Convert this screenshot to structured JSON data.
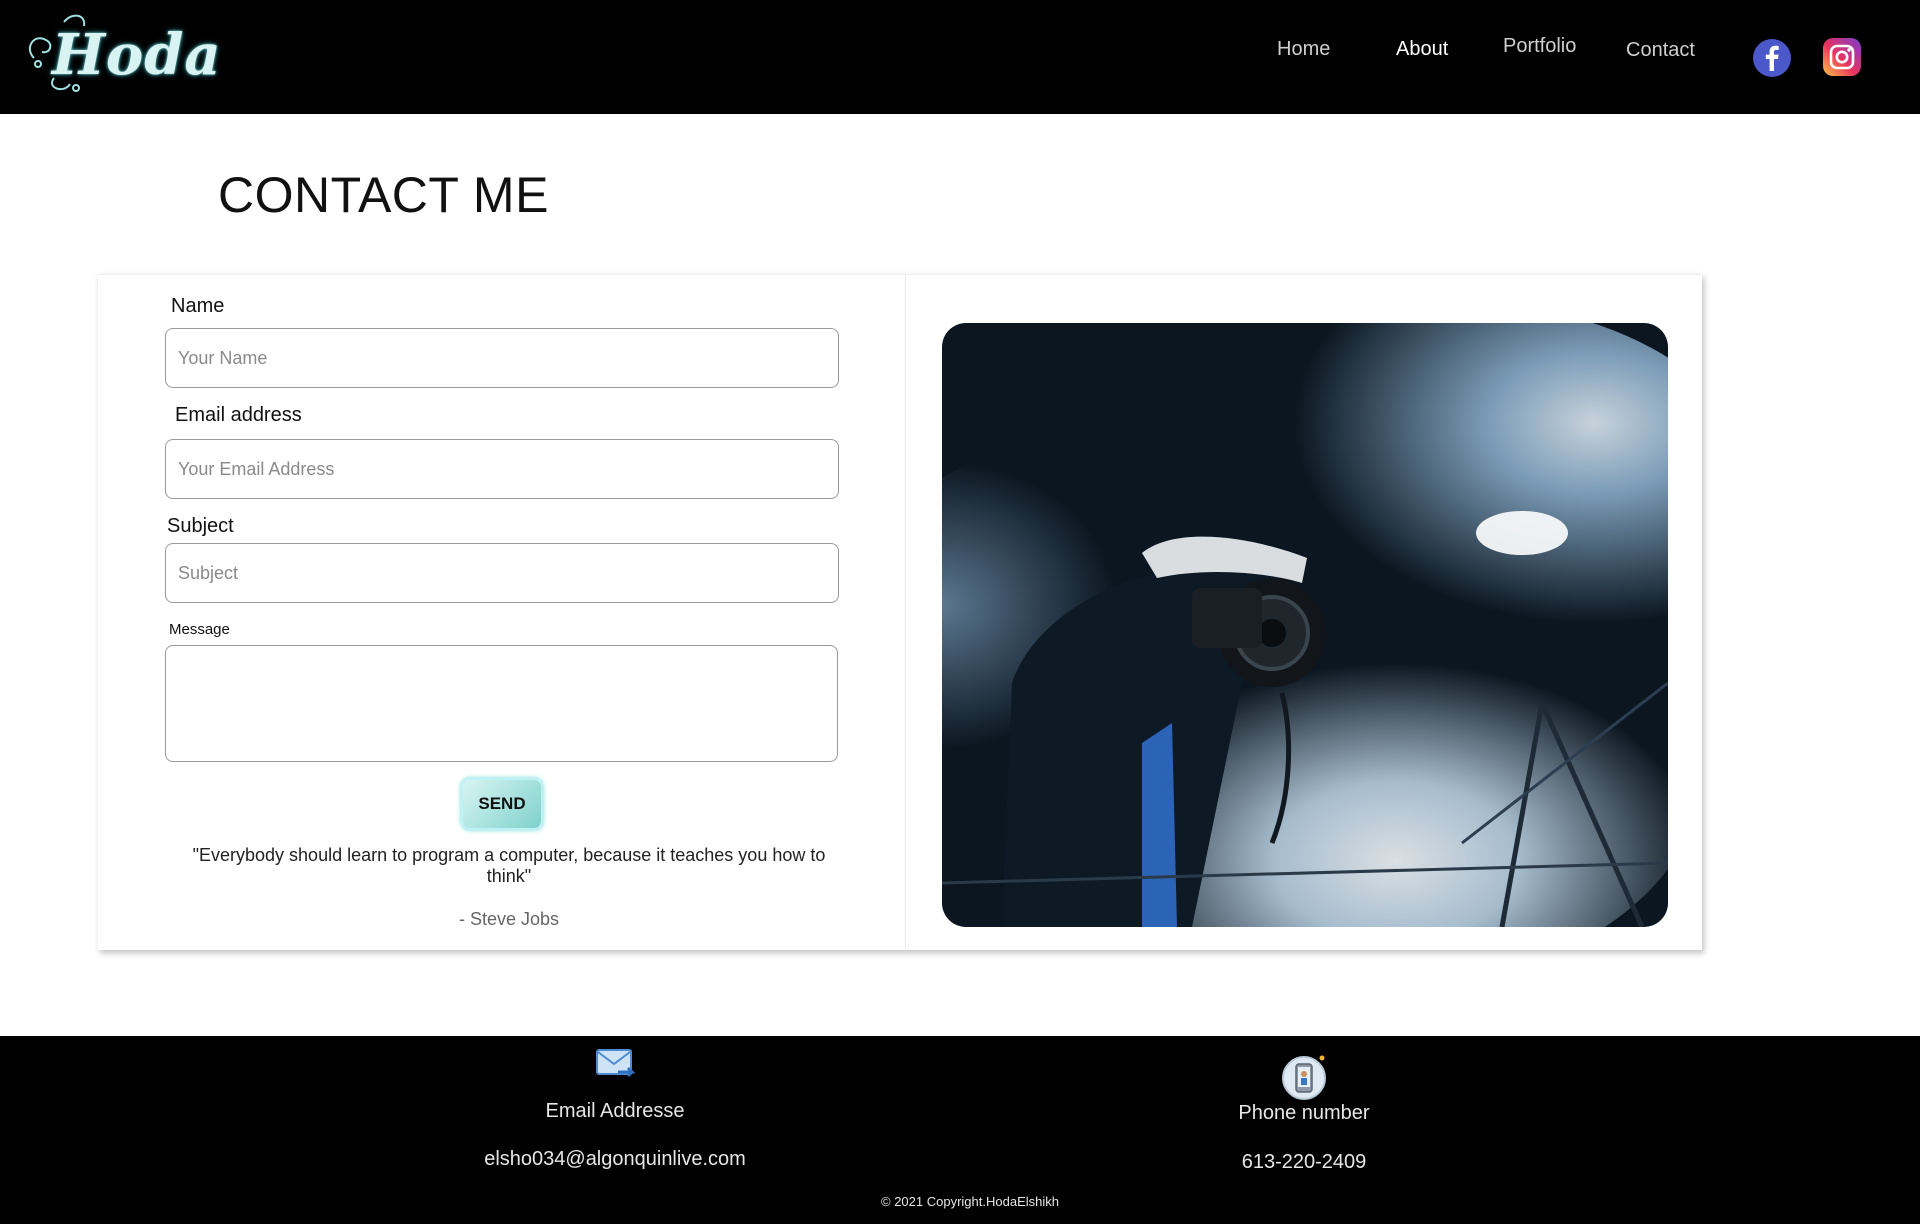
{
  "brand": {
    "logo_text": "Hoda",
    "logo_icon": "ornate-script-logo"
  },
  "nav": {
    "items": [
      {
        "label": "Home",
        "active": false
      },
      {
        "label": "About",
        "active": true
      },
      {
        "label": "Portfolio",
        "active": false
      },
      {
        "label": "Contact",
        "active": false
      }
    ],
    "social": [
      {
        "icon": "facebook-icon",
        "color": "#4a58c9"
      },
      {
        "icon": "instagram-icon",
        "color": "#d6317d"
      }
    ]
  },
  "page": {
    "title": "CONTACT ME"
  },
  "form": {
    "name": {
      "label": "Name",
      "placeholder": "Your Name",
      "value": ""
    },
    "email": {
      "label": "Email address",
      "placeholder": "Your Email Address",
      "value": ""
    },
    "subject": {
      "label": "Subject",
      "placeholder": "Subject",
      "value": ""
    },
    "message": {
      "label": "Message",
      "value": ""
    },
    "send_label": "SEND"
  },
  "quote": {
    "text": "\"Everybody should learn to program a computer, because it teaches you how to think\"",
    "author": "- Steve Jobs"
  },
  "photo": {
    "subject": "photographer-with-camera-in-smoke"
  },
  "footer": {
    "email_label": "Email Addresse",
    "email_value": "elsho034@algonquinlive.com",
    "phone_label": "Phone number",
    "phone_value": "613-220-2409",
    "copyright": "© 2021 Copyright.HodaElshikh"
  },
  "colors": {
    "header_bg": "#000000",
    "footer_bg": "#000000",
    "accent_teal": "#7fd1cc",
    "logo_color": "#d9f3f2"
  }
}
